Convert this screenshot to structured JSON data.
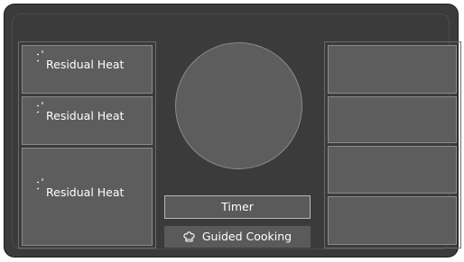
{
  "left_zones": [
    {
      "icon": "residual-heat-icon",
      "label": "Residual Heat"
    },
    {
      "icon": "residual-heat-icon",
      "label": "Residual Heat"
    },
    {
      "icon": "residual-heat-icon",
      "label": "Residual Heat"
    }
  ],
  "center": {
    "timer_label": "Timer",
    "guided_icon": "chef-hat-icon",
    "guided_label": "Guided Cooking"
  },
  "right_zones": [
    {
      "label": ""
    },
    {
      "label": ""
    },
    {
      "label": ""
    },
    {
      "label": ""
    }
  ],
  "colors": {
    "background": "#3b3b3b",
    "zone_fill": "#5d5d5d",
    "zone_border": "#8a8a8a",
    "text": "#ffffff"
  }
}
